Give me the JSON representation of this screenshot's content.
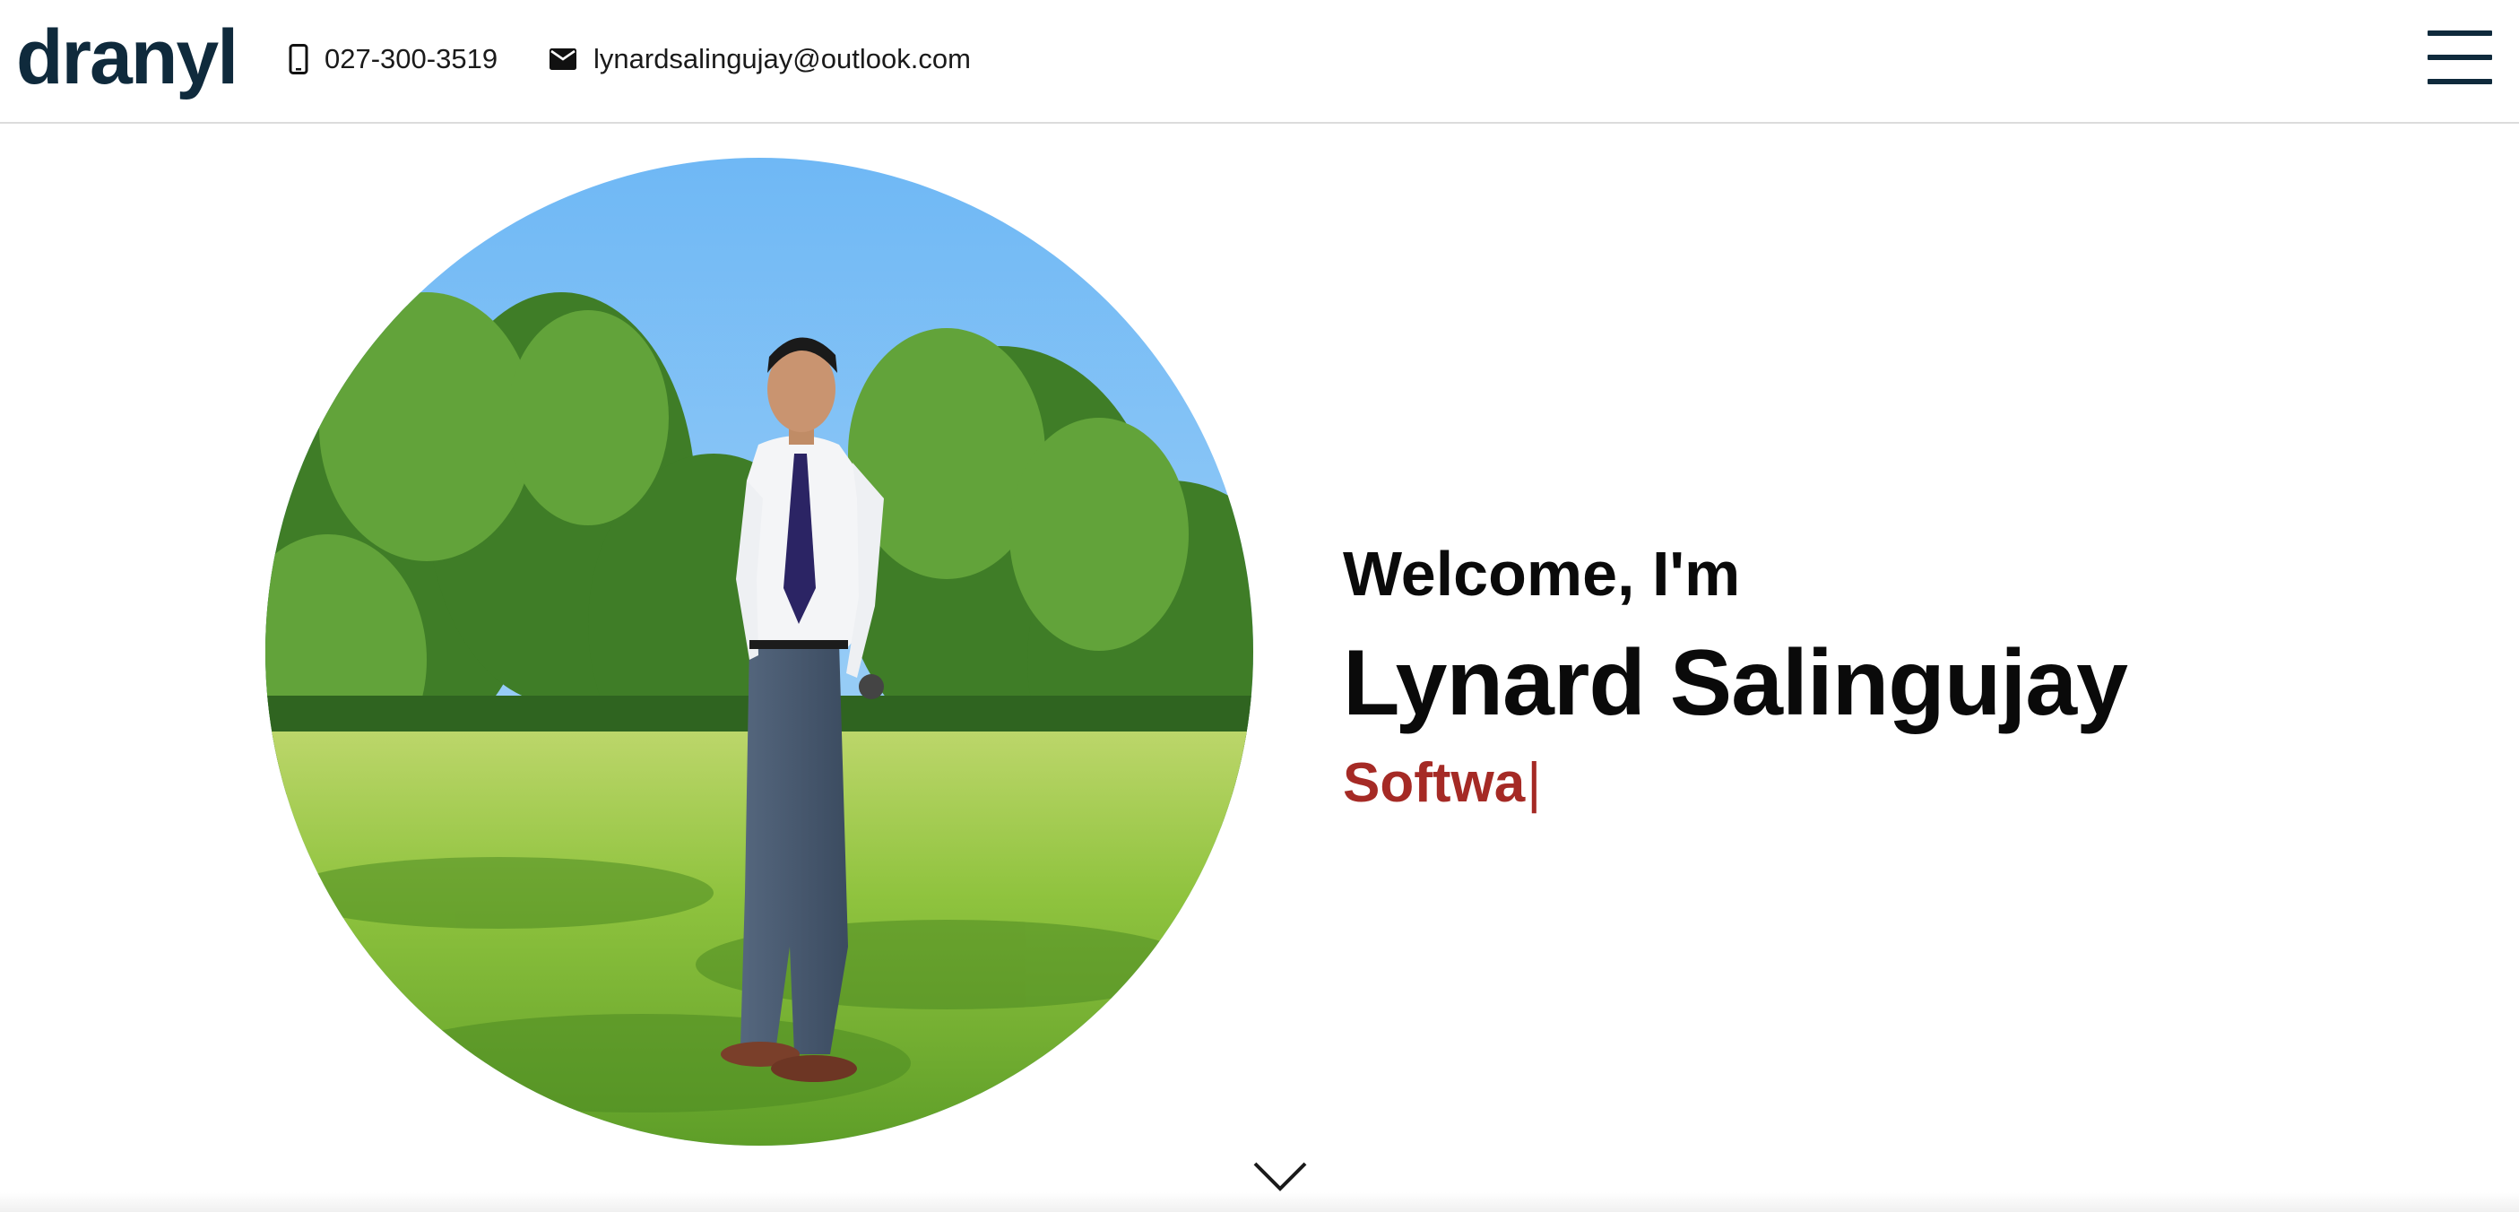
{
  "header": {
    "logo": "dranyl",
    "phone": "027-300-3519",
    "email": "lynardsalingujay@outlook.com",
    "icons": {
      "phone": "mobile-phone-icon",
      "email": "envelope-icon",
      "menu": "hamburger-menu-icon"
    }
  },
  "hero": {
    "greeting": "Welcome, I'm",
    "name": "Lynard Salingujay",
    "role_typed": "Softwa",
    "cursor": "|",
    "scroll_icon": "chevron-down-icon"
  },
  "colors": {
    "brand_dark": "#0f2a3c",
    "accent_red": "#a52a25",
    "text": "#0a0a0a"
  }
}
